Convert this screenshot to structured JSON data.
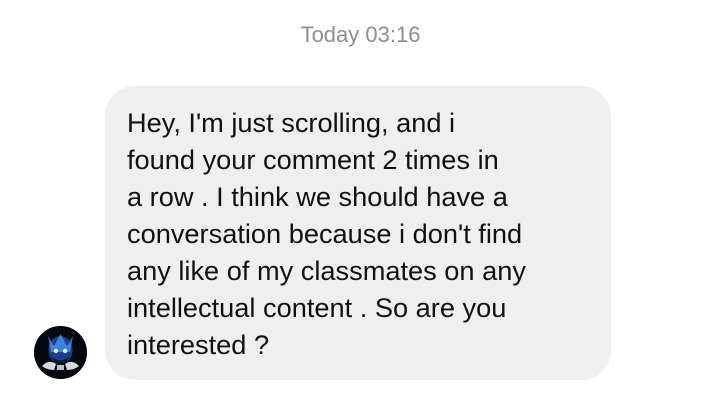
{
  "chat": {
    "timestamp": "Today 03:16",
    "messages": [
      {
        "sender": "other",
        "text": "Hey, I'm just scrolling, and i\nfound your comment 2 times in\na row . I think we should have a\nconversation because i don't find\nany like of my classmates on any\nintellectual content . So are you\ninterested ?"
      }
    ]
  },
  "colors": {
    "bubble_background": "#efefef",
    "timestamp_text": "#8e8e8e",
    "message_text": "#111111"
  },
  "icons": {
    "avatar": "user-avatar-icon"
  }
}
